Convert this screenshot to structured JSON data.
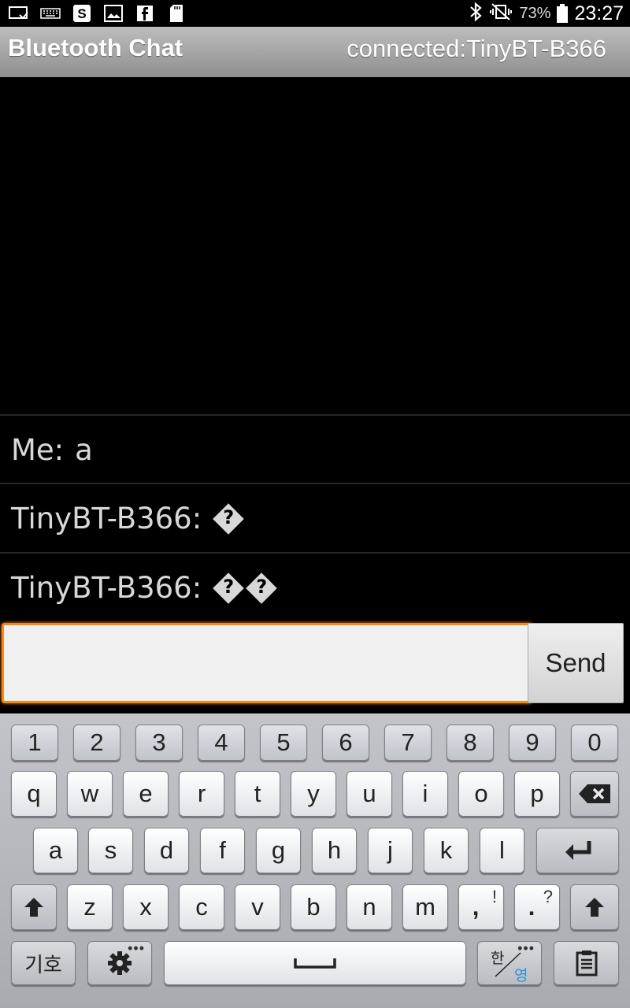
{
  "status_bar": {
    "icons": [
      "cast-icon",
      "keyboard-icon",
      "skype-icon",
      "gallery-icon",
      "facebook-icon",
      "sd-card-icon"
    ],
    "bluetooth_icon": "bluetooth-icon",
    "mute_icon": "vibrate-off-icon",
    "battery": "73%",
    "time": "23:27"
  },
  "title_bar": {
    "title": "Bluetooth Chat",
    "connection": "connected:TinyBT-B366"
  },
  "messages": [
    {
      "sender": "Me:",
      "text": "a",
      "replacement_chars": 0
    },
    {
      "sender": "TinyBT-B366:",
      "text": "",
      "replacement_chars": 1
    },
    {
      "sender": "TinyBT-B366:",
      "text": "",
      "replacement_chars": 2
    }
  ],
  "compose": {
    "input_value": "",
    "send_label": "Send"
  },
  "keyboard": {
    "number_row": [
      "1",
      "2",
      "3",
      "4",
      "5",
      "6",
      "7",
      "8",
      "9",
      "0"
    ],
    "row1": [
      "q",
      "w",
      "e",
      "r",
      "t",
      "y",
      "u",
      "i",
      "o",
      "p"
    ],
    "row2": [
      "a",
      "s",
      "d",
      "f",
      "g",
      "h",
      "j",
      "k",
      "l"
    ],
    "row3": [
      "z",
      "x",
      "c",
      "v",
      "b",
      "n",
      "m"
    ],
    "comma_key": ",",
    "comma_sup": "!",
    "period_key": ".",
    "period_sup": "?",
    "symbols_label": "기호",
    "lang_top": "한",
    "lang_bottom": "영",
    "accent_color": "#f08a1c"
  }
}
